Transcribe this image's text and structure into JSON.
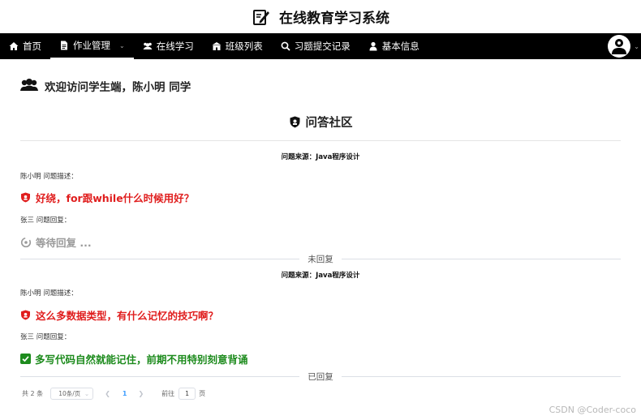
{
  "app": {
    "title": "在线教育学习系统"
  },
  "nav": {
    "items": [
      {
        "label": "首页"
      },
      {
        "label": "作业管理"
      },
      {
        "label": "在线学习"
      },
      {
        "label": "班级列表"
      },
      {
        "label": "习题提交记录"
      },
      {
        "label": "基本信息"
      }
    ],
    "active_index": 1
  },
  "welcome": {
    "text": "欢迎访问学生端，陈小明 同学"
  },
  "section": {
    "title": "问答社区"
  },
  "questions": [
    {
      "source": "问题来源：Java程序设计",
      "asker_label": "陈小明 问题描述：",
      "question": "好绕，for跟while什么时候用好？",
      "replier_label": "张三 问题回复：",
      "answer": "等待回复 ...",
      "status": "未回复"
    },
    {
      "source": "问题来源：Java程序设计",
      "asker_label": "陈小明 问题描述：",
      "question": "这么多数据类型，有什么记忆的技巧啊？",
      "replier_label": "张三 问题回复：",
      "answer": "多写代码自然就能记住，前期不用特别刻意背诵",
      "status": "已回复"
    }
  ],
  "pager": {
    "total": "共 2 条",
    "page_size": "10条/页",
    "current_page": "1",
    "goto_label": "前往",
    "goto_value": "1",
    "page_suffix": "页"
  },
  "watermark": "CSDN @Coder-coco",
  "colors": {
    "nav_bg": "#000000",
    "question": "#e01e1e",
    "answered": "#1d8b1d",
    "pending": "#9a9a9a",
    "link": "#409eff"
  }
}
